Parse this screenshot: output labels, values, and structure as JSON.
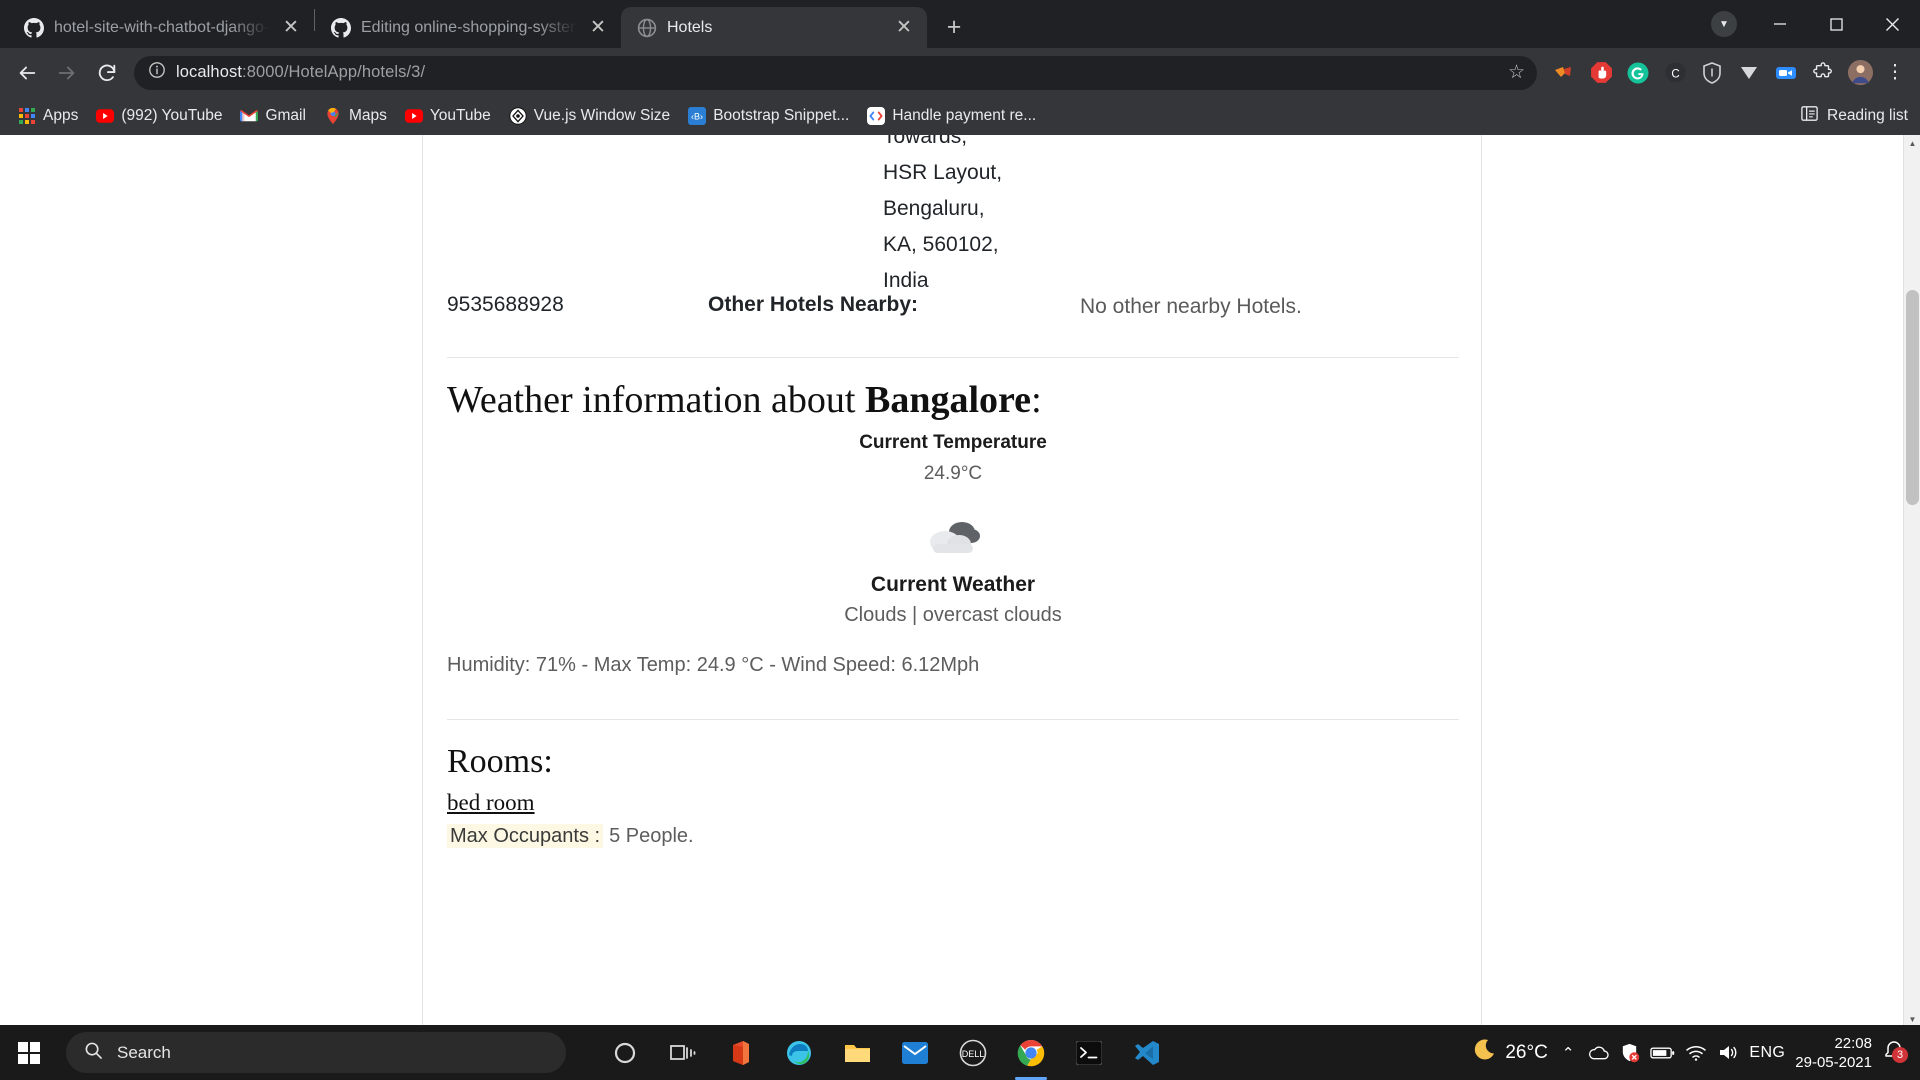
{
  "browser": {
    "tabs": [
      {
        "title": "hotel-site-with-chatbot-django-m",
        "icon": "github-icon",
        "active": false,
        "close": "✕"
      },
      {
        "title": "Editing online-shopping-system-a",
        "icon": "github-icon",
        "active": false,
        "close": "✕"
      },
      {
        "title": "Hotels",
        "icon": "globe-icon",
        "active": true,
        "close": "✕"
      }
    ],
    "new_tab_label": "+",
    "window_controls": {
      "minimize": "—",
      "maximize": "▢",
      "close": "✕",
      "profile_caret": "▼"
    },
    "nav": {
      "back": "←",
      "forward": "→",
      "reload": "⟳"
    },
    "omnibox": {
      "site_info_icon": "info-circle-icon",
      "url_host": "localhost",
      "url_rest": ":8000/HotelApp/hotels/3/",
      "bookmark_star": "☆"
    },
    "extensions": [
      "adobe-acrobat-icon",
      "adblock-icon",
      "grammarly-icon",
      "clickup-icon",
      "brave-shield-icon",
      "vimeo-icon",
      "zoom-icon",
      "puzzle-extensions-icon",
      "profile-avatar-icon",
      "chrome-menu-icon"
    ],
    "bookmarks": [
      {
        "label": "Apps",
        "icon": "apps-grid-icon"
      },
      {
        "label": "(992) YouTube",
        "icon": "youtube-icon"
      },
      {
        "label": "Gmail",
        "icon": "gmail-icon"
      },
      {
        "label": "Maps",
        "icon": "google-maps-icon"
      },
      {
        "label": "YouTube",
        "icon": "youtube-icon"
      },
      {
        "label": "Vue.js Window Size",
        "icon": "vuejs-window-size-icon"
      },
      {
        "label": "Bootstrap Snippet...",
        "icon": "bootstrap-icon"
      },
      {
        "label": "Handle payment re...",
        "icon": "code-brackets-icon"
      }
    ],
    "reading_list": {
      "label": "Reading list",
      "icon": "reading-list-icon"
    }
  },
  "page": {
    "address_lines": [
      "Towards,",
      "HSR Layout,",
      "Bengaluru,",
      "KA, 560102,",
      "India"
    ],
    "phone": "9535688928",
    "nearby_label": "Other Hotels Nearby:",
    "nearby_value": "No other nearby Hotels.",
    "weather": {
      "heading_prefix": "Weather information about ",
      "city": "Bangalore",
      "heading_suffix": ":",
      "current_temperature_label": "Current Temperature",
      "current_temperature_value": "24.9°C",
      "icon": "overcast-clouds-icon",
      "current_weather_label": "Current Weather",
      "current_weather_value": "Clouds | overcast clouds",
      "details": "Humidity: 71% - Max Temp: 24.9 °C - Wind Speed: 6.12Mph"
    },
    "rooms": {
      "heading": "Rooms:",
      "room_name": "bed room",
      "max_occupants_label": "Max Occupants :",
      "max_occupants_value": "5 People."
    }
  },
  "scrollbar": {
    "up": "▲",
    "down": "▼"
  },
  "taskbar": {
    "start_icon": "windows-start-icon",
    "search_placeholder": "Search",
    "search_icon": "search-icon",
    "apps": [
      "cortana-icon",
      "task-view-icon",
      "office-icon",
      "microsoft-edge-icon",
      "file-explorer-icon",
      "mail-icon",
      "dell-icon",
      "google-chrome-icon",
      "terminal-icon",
      "vs-code-icon"
    ],
    "tray": {
      "weather_icon": "moon-icon",
      "weather_temp": "26°C",
      "overflow": "⌃",
      "icons": [
        "onedrive-icon",
        "antivirus-icon",
        "battery-icon",
        "wifi-icon",
        "volume-icon"
      ],
      "language": "ENG",
      "time": "22:08",
      "date": "29-05-2021",
      "notification_icon": "notification-bell-icon",
      "notification_count": "3"
    }
  },
  "colors": {
    "chrome_dark": "#202124",
    "chrome_toolbar": "#35363a",
    "taskbar": "#1a1a1a",
    "accent_blue": "#60a5fa",
    "highlight_yellow": "#fcf8e3"
  }
}
